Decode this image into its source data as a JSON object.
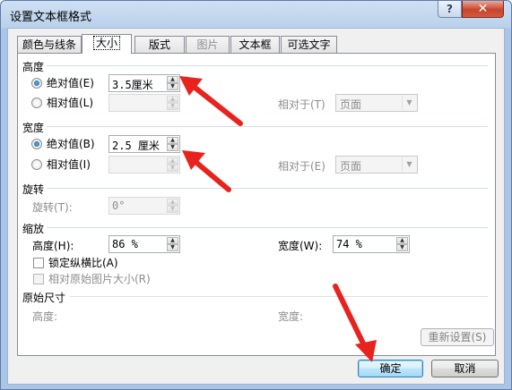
{
  "window": {
    "title": "设置文本框格式",
    "help_label": "?",
    "close_label": "✕"
  },
  "tabs": [
    {
      "label": "颜色与线条"
    },
    {
      "label": "大小"
    },
    {
      "label": "版式"
    },
    {
      "label": "图片"
    },
    {
      "label": "文本框"
    },
    {
      "label": "可选文字"
    }
  ],
  "height_section": {
    "title": "高度",
    "absolute_label": "绝对值(E)",
    "absolute_value": "3.5厘米",
    "relative_label": "相对值(L)",
    "relative_value": "",
    "relative_to_label": "相对于(T)",
    "relative_to_value": "页面"
  },
  "width_section": {
    "title": "宽度",
    "absolute_label": "绝对值(B)",
    "absolute_value": "2.5 厘米",
    "relative_label": "相对值(I)",
    "relative_value": "",
    "relative_to_label": "相对于(E)",
    "relative_to_value": "页面"
  },
  "rotate_section": {
    "title": "旋转",
    "rotate_label": "旋转(T):",
    "rotate_value": "0°"
  },
  "scale_section": {
    "title": "缩放",
    "height_label": "高度(H):",
    "height_value": "86 %",
    "width_label": "宽度(W):",
    "width_value": "74 %",
    "lock_ratio_label": "锁定纵横比(A)",
    "relative_original_label": "相对原始图片大小(R)"
  },
  "original_section": {
    "title": "原始尺寸",
    "height_label": "高度:",
    "width_label": "宽度:",
    "reset_label": "重新设置(S)"
  },
  "footer": {
    "ok_label": "确定",
    "cancel_label": "取消"
  },
  "colors": {
    "annotation_arrow": "#e8231e"
  }
}
